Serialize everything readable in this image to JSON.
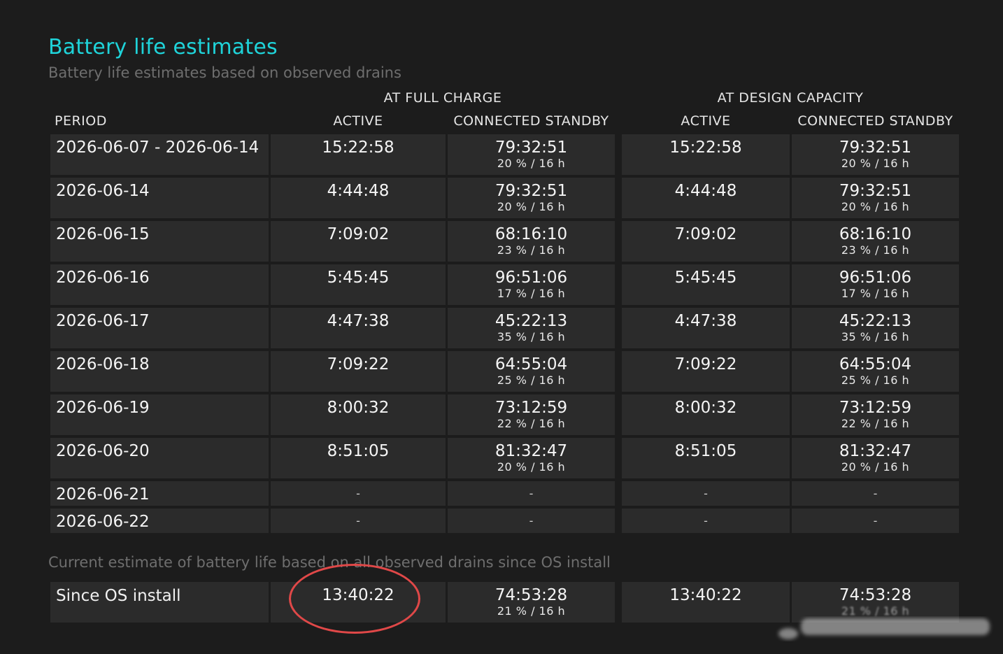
{
  "header": {
    "title": "Battery life estimates",
    "subtitle": "Battery life estimates based on observed drains"
  },
  "table": {
    "group_full": "AT FULL CHARGE",
    "group_design": "AT DESIGN CAPACITY",
    "col_period": "PERIOD",
    "col_active": "ACTIVE",
    "col_standby": "CONNECTED STANDBY",
    "rows": [
      {
        "period": "2026-06-07 - 2026-06-14",
        "fc_active": "15:22:58",
        "fc_standby": "79:32:51",
        "fc_standby_sub": "20 % / 16 h",
        "dc_active": "15:22:58",
        "dc_standby": "79:32:51",
        "dc_standby_sub": "20 % / 16 h"
      },
      {
        "period": "2026-06-14",
        "fc_active": "4:44:48",
        "fc_standby": "79:32:51",
        "fc_standby_sub": "20 % / 16 h",
        "dc_active": "4:44:48",
        "dc_standby": "79:32:51",
        "dc_standby_sub": "20 % / 16 h"
      },
      {
        "period": "2026-06-15",
        "fc_active": "7:09:02",
        "fc_standby": "68:16:10",
        "fc_standby_sub": "23 % / 16 h",
        "dc_active": "7:09:02",
        "dc_standby": "68:16:10",
        "dc_standby_sub": "23 % / 16 h"
      },
      {
        "period": "2026-06-16",
        "fc_active": "5:45:45",
        "fc_standby": "96:51:06",
        "fc_standby_sub": "17 % / 16 h",
        "dc_active": "5:45:45",
        "dc_standby": "96:51:06",
        "dc_standby_sub": "17 % / 16 h"
      },
      {
        "period": "2026-06-17",
        "fc_active": "4:47:38",
        "fc_standby": "45:22:13",
        "fc_standby_sub": "35 % / 16 h",
        "dc_active": "4:47:38",
        "dc_standby": "45:22:13",
        "dc_standby_sub": "35 % / 16 h"
      },
      {
        "period": "2026-06-18",
        "fc_active": "7:09:22",
        "fc_standby": "64:55:04",
        "fc_standby_sub": "25 % / 16 h",
        "dc_active": "7:09:22",
        "dc_standby": "64:55:04",
        "dc_standby_sub": "25 % / 16 h"
      },
      {
        "period": "2026-06-19",
        "fc_active": "8:00:32",
        "fc_standby": "73:12:59",
        "fc_standby_sub": "22 % / 16 h",
        "dc_active": "8:00:32",
        "dc_standby": "73:12:59",
        "dc_standby_sub": "22 % / 16 h"
      },
      {
        "period": "2026-06-20",
        "fc_active": "8:51:05",
        "fc_standby": "81:32:47",
        "fc_standby_sub": "20 % / 16 h",
        "dc_active": "8:51:05",
        "dc_standby": "81:32:47",
        "dc_standby_sub": "20 % / 16 h"
      },
      {
        "period": "2026-06-21",
        "fc_active": "-",
        "fc_standby": "-",
        "fc_standby_sub": "",
        "dc_active": "-",
        "dc_standby": "-",
        "dc_standby_sub": ""
      },
      {
        "period": "2026-06-22",
        "fc_active": "-",
        "fc_standby": "-",
        "fc_standby_sub": "",
        "dc_active": "-",
        "dc_standby": "-",
        "dc_standby_sub": ""
      }
    ]
  },
  "current": {
    "note": "Current estimate of battery life based on all observed drains since OS install",
    "label": "Since OS install",
    "fc_active": "13:40:22",
    "fc_standby": "74:53:28",
    "fc_standby_sub": "21 % / 16 h",
    "dc_active": "13:40:22",
    "dc_standby": "74:53:28",
    "dc_standby_sub": "21 % / 16 h"
  },
  "annotation": {
    "circle_color": "#e04848"
  }
}
